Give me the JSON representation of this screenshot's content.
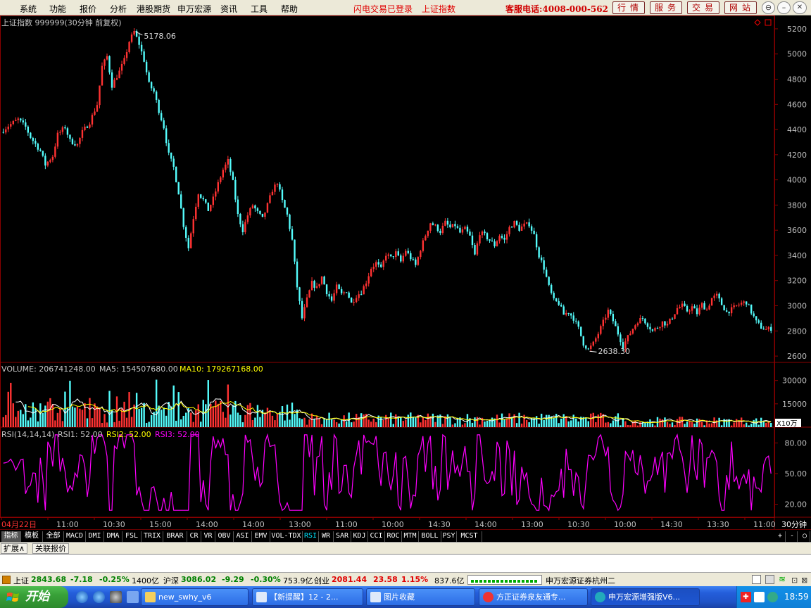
{
  "menu": [
    "系统",
    "功能",
    "报价",
    "分析",
    "港股期货",
    "申万宏源",
    "资讯",
    "工具",
    "帮助"
  ],
  "status_msgs": [
    "闪电交易已登录",
    "上证指数"
  ],
  "hotline": "客服电话:4008-000-562",
  "top_buttons": [
    "行情",
    "服务",
    "交易",
    "网站"
  ],
  "window_buttons": [
    "restore-icon",
    "minimize-icon",
    "maximize-icon",
    "close-icon"
  ],
  "chart_data": {
    "type": "candlestick",
    "title": "上证指数 999999(30分钟 前复权)",
    "high_label": "5178.06",
    "low_label": "2638.30",
    "ylim": [
      2550,
      5250
    ],
    "y_ticks": [
      "5200",
      "5000",
      "4800",
      "4600",
      "4400",
      "4200",
      "4000",
      "3800",
      "3600",
      "3400",
      "3200",
      "3000",
      "2800",
      "2600"
    ],
    "anchors": [
      [
        0,
        4380
      ],
      [
        3,
        4430
      ],
      [
        7,
        4480
      ],
      [
        10,
        4420
      ],
      [
        12,
        4340
      ],
      [
        16,
        4230
      ],
      [
        18,
        4120
      ],
      [
        21,
        4190
      ],
      [
        23,
        4360
      ],
      [
        26,
        4420
      ],
      [
        28,
        4310
      ],
      [
        31,
        4280
      ],
      [
        33,
        4380
      ],
      [
        36,
        4460
      ],
      [
        39,
        4600
      ],
      [
        41,
        4900
      ],
      [
        43,
        4980
      ],
      [
        45,
        4750
      ],
      [
        48,
        4860
      ],
      [
        50,
        4950
      ],
      [
        52,
        5100
      ],
      [
        54,
        5178
      ],
      [
        56,
        5080
      ],
      [
        58,
        4950
      ],
      [
        60,
        4760
      ],
      [
        62,
        4700
      ],
      [
        64,
        4550
      ],
      [
        66,
        4420
      ],
      [
        68,
        4200
      ],
      [
        70,
        4100
      ],
      [
        72,
        3900
      ],
      [
        74,
        3640
      ],
      [
        76,
        3460
      ],
      [
        78,
        3700
      ],
      [
        80,
        3900
      ],
      [
        82,
        3840
      ],
      [
        84,
        3760
      ],
      [
        86,
        3850
      ],
      [
        88,
        3970
      ],
      [
        90,
        4080
      ],
      [
        92,
        4150
      ],
      [
        94,
        3980
      ],
      [
        96,
        3720
      ],
      [
        98,
        3600
      ],
      [
        100,
        3720
      ],
      [
        102,
        3800
      ],
      [
        104,
        3740
      ],
      [
        106,
        3690
      ],
      [
        108,
        3800
      ],
      [
        110,
        3920
      ],
      [
        112,
        3980
      ],
      [
        114,
        3830
      ],
      [
        116,
        3720
      ],
      [
        118,
        3520
      ],
      [
        120,
        3150
      ],
      [
        122,
        2900
      ],
      [
        124,
        3050
      ],
      [
        126,
        3180
      ],
      [
        128,
        3140
      ],
      [
        130,
        3230
      ],
      [
        132,
        3110
      ],
      [
        134,
        3040
      ],
      [
        136,
        3150
      ],
      [
        138,
        3090
      ],
      [
        140,
        3120
      ],
      [
        142,
        3020
      ],
      [
        144,
        3080
      ],
      [
        146,
        3110
      ],
      [
        148,
        3190
      ],
      [
        150,
        3300
      ],
      [
        152,
        3340
      ],
      [
        154,
        3290
      ],
      [
        156,
        3410
      ],
      [
        158,
        3380
      ],
      [
        160,
        3420
      ],
      [
        162,
        3350
      ],
      [
        164,
        3440
      ],
      [
        166,
        3380
      ],
      [
        168,
        3320
      ],
      [
        170,
        3450
      ],
      [
        172,
        3560
      ],
      [
        174,
        3660
      ],
      [
        176,
        3630
      ],
      [
        178,
        3590
      ],
      [
        180,
        3660
      ],
      [
        182,
        3620
      ],
      [
        184,
        3640
      ],
      [
        186,
        3580
      ],
      [
        188,
        3610
      ],
      [
        190,
        3550
      ],
      [
        192,
        3400
      ],
      [
        194,
        3580
      ],
      [
        196,
        3560
      ],
      [
        198,
        3520
      ],
      [
        200,
        3480
      ],
      [
        202,
        3560
      ],
      [
        204,
        3520
      ],
      [
        206,
        3620
      ],
      [
        208,
        3660
      ],
      [
        210,
        3610
      ],
      [
        212,
        3640
      ],
      [
        214,
        3650
      ],
      [
        216,
        3560
      ],
      [
        218,
        3400
      ],
      [
        220,
        3300
      ],
      [
        222,
        3150
      ],
      [
        224,
        3040
      ],
      [
        226,
        3020
      ],
      [
        228,
        2930
      ],
      [
        230,
        2950
      ],
      [
        232,
        2900
      ],
      [
        234,
        2820
      ],
      [
        236,
        2700
      ],
      [
        238,
        2650
      ],
      [
        240,
        2700
      ],
      [
        242,
        2780
      ],
      [
        244,
        2870
      ],
      [
        246,
        2960
      ],
      [
        248,
        2880
      ],
      [
        250,
        2780
      ],
      [
        252,
        2680
      ],
      [
        254,
        2750
      ],
      [
        256,
        2820
      ],
      [
        258,
        2880
      ],
      [
        260,
        2900
      ],
      [
        262,
        2850
      ],
      [
        264,
        2800
      ],
      [
        266,
        2830
      ],
      [
        268,
        2870
      ],
      [
        270,
        2850
      ],
      [
        272,
        2910
      ],
      [
        274,
        2980
      ],
      [
        276,
        3000
      ],
      [
        278,
        2960
      ],
      [
        280,
        2990
      ],
      [
        282,
        2940
      ],
      [
        284,
        3010
      ],
      [
        286,
        2970
      ],
      [
        288,
        3060
      ],
      [
        290,
        3080
      ],
      [
        292,
        3010
      ],
      [
        294,
        2950
      ],
      [
        296,
        2970
      ],
      [
        298,
        3000
      ],
      [
        300,
        3020
      ],
      [
        302,
        3030
      ],
      [
        304,
        2950
      ],
      [
        306,
        2870
      ],
      [
        308,
        2830
      ],
      [
        310,
        2810
      ],
      [
        312,
        2820
      ]
    ],
    "volume": {
      "label": "VOLUME: 206741248.00",
      "ma5": "MA5: 154507680.00",
      "ma10": "MA10: 179267168.00",
      "ticks": [
        "30000",
        "15000"
      ],
      "unit": "X10万",
      "ylim": [
        0,
        38000
      ]
    },
    "rsi": {
      "label": "RSI(14,14,14)",
      "rsi1": "RSI1: 52.00",
      "rsi2": "RSI2: 52.00",
      "rsi3": "RSI3: 52.00",
      "ticks": [
        "80.00",
        "50.00",
        "20.00"
      ],
      "ylim": [
        10,
        90
      ]
    },
    "x_labels": [
      "04月22日",
      "11:00",
      "10:30",
      "15:00",
      "14:00",
      "14:00",
      "13:00",
      "11:00",
      "10:00",
      "14:30",
      "14:00",
      "13:00",
      "10:30",
      "10:00",
      "14:30",
      "13:30",
      "11:00",
      "10:30"
    ],
    "period": "30分钟"
  },
  "indicator_tabs": [
    "指标",
    "模板",
    "全部",
    "MACD",
    "DMI",
    "DMA",
    "FSL",
    "TRIX",
    "BRAR",
    "CR",
    "VR",
    "OBV",
    "ASI",
    "EMV",
    "VOL-TDX",
    "RSI",
    "WR",
    "SAR",
    "KDJ",
    "CCI",
    "ROC",
    "MTM",
    "BOLL",
    "PSY",
    "MCST"
  ],
  "active_tab": "RSI",
  "tab_controls": [
    "+",
    "-",
    "○"
  ],
  "sub_buttons": [
    "扩展∧",
    "关联报价"
  ],
  "ticker": {
    "sh_name": "上证",
    "sh_val": "2843.68",
    "sh_chg": "-7.18",
    "sh_pct": "-0.25%",
    "sh_amt": "1400亿",
    "hs_name": "沪深",
    "hs_val": "3086.02",
    "hs_chg": "-9.29",
    "hs_pct": "-0.30%",
    "hs_amt": "753.9亿",
    "cy_name": "创业",
    "cy_val": "2081.44",
    "cy_chg": "23.58",
    "cy_pct": "1.15%",
    "cy_amt": "837.6亿",
    "broker": "申万宏源证券杭州二"
  },
  "taskbar": {
    "start": "开始",
    "items": [
      "new_swhy_v6",
      "【新提醒】12 - 2...",
      "图片收藏",
      "方正证券泉友通专...",
      "申万宏源增强版V6..."
    ],
    "active": 4,
    "clock": "18:59"
  },
  "colors": {
    "up": "#ff3232",
    "down": "#54fcfc",
    "grid": "#8b0000",
    "axis_text": "#c0c0c0",
    "ma5": "#ffffff",
    "ma10": "#ffff00",
    "rsi": "#ff00ff"
  }
}
